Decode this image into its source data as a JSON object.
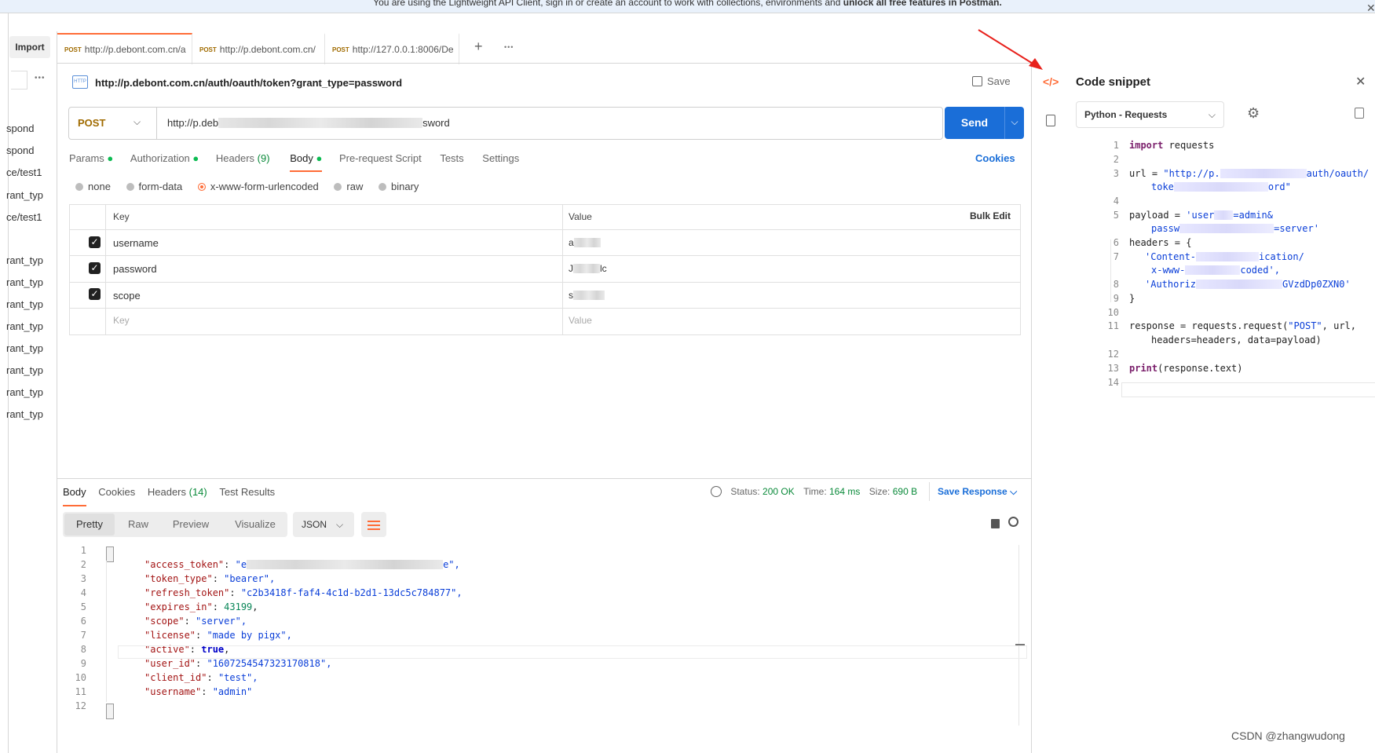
{
  "banner": {
    "text_a": "You are using the Lightweight API Client, sign in or create an account to work with collections, environments and ",
    "text_b": "unlock all free features in Postman."
  },
  "sidebar": {
    "import_label": "Import",
    "items": [
      "spond",
      "spond",
      "ce/test1",
      "rant_typ",
      "ce/test1",
      "rant_typ",
      "rant_typ",
      "rant_typ",
      "rant_typ",
      "rant_typ",
      "rant_typ",
      "rant_typ",
      "rant_typ"
    ]
  },
  "tabs": [
    {
      "method": "POST",
      "url": "http://p.debont.com.cn/a"
    },
    {
      "method": "POST",
      "url": "http://p.debont.com.cn/"
    },
    {
      "method": "POST",
      "url": "http://127.0.0.1:8006/De"
    }
  ],
  "request": {
    "title": "http://p.debont.com.cn/auth/oauth/token?grant_type=password",
    "save_label": "Save",
    "method": "POST",
    "url_start": "http://p.deb",
    "url_end": "sword",
    "send_label": "Send",
    "subtabs": [
      "Params",
      "Authorization",
      "Headers",
      "(9)",
      "Body",
      "Pre-request Script",
      "Tests",
      "Settings"
    ],
    "cookies_label": "Cookies",
    "body_types": [
      "none",
      "form-data",
      "x-www-form-urlencoded",
      "raw",
      "binary"
    ],
    "table": {
      "key_header": "Key",
      "value_header": "Value",
      "bulk_edit": "Bulk Edit",
      "rows": [
        {
          "key": "username",
          "value": "a"
        },
        {
          "key": "password",
          "value": "J",
          "value_tail": "lc"
        },
        {
          "key": "scope",
          "value": "s"
        }
      ],
      "placeholder_key": "Key",
      "placeholder_value": "Value"
    }
  },
  "response": {
    "tabs": [
      "Body",
      "Cookies",
      "Headers",
      "(14)",
      "Test Results"
    ],
    "status_label": "Status:",
    "status_value": "200 OK",
    "time_label": "Time:",
    "time_value": "164 ms",
    "size_label": "Size:",
    "size_value": "690 B",
    "save_response": "Save Response",
    "views": [
      "Pretty",
      "Raw",
      "Preview",
      "Visualize"
    ],
    "format": "JSON",
    "json_lines": [
      {
        "n": "1",
        "t": "{"
      },
      {
        "n": "2",
        "k": "\"access_token\"",
        "v": "\"e",
        "v2": "e\","
      },
      {
        "n": "3",
        "k": "\"token_type\"",
        "v": "\"bearer\","
      },
      {
        "n": "4",
        "k": "\"refresh_token\"",
        "v": "\"c2b3418f-faf4-4c1d-b2d1-13dc5c784877\","
      },
      {
        "n": "5",
        "k": "\"expires_in\"",
        "num": "43199",
        "tail": ","
      },
      {
        "n": "6",
        "k": "\"scope\"",
        "v": "\"server\","
      },
      {
        "n": "7",
        "k": "\"license\"",
        "v": "\"made by pigx\","
      },
      {
        "n": "8",
        "k": "\"active\"",
        "bool": "true",
        "tail": ","
      },
      {
        "n": "9",
        "k": "\"user_id\"",
        "v": "\"1607254547323170818\","
      },
      {
        "n": "10",
        "k": "\"client_id\"",
        "v": "\"test\","
      },
      {
        "n": "11",
        "k": "\"username\"",
        "v": "\"admin\""
      },
      {
        "n": "12",
        "t": "}"
      }
    ]
  },
  "snippet": {
    "title": "Code snippet",
    "language": "Python - Requests",
    "lines": {
      "l1_kw": "import",
      "l1_rest": " requests",
      "l3_a": "url = ",
      "l3_s": "\"http://p.",
      "l3_s2": "auth/oauth/",
      "l3b_s": "toke",
      "l3b_s2": "ord\"",
      "l5_a": "payload = ",
      "l5_s": "'user",
      "l5_s2": "=admin&",
      "l5b_s": "passw",
      "l5b_s2": "=server'",
      "l6": "headers = {",
      "l7_s": "'Content-",
      "l7_s2": "ication/",
      "l7b_s": "x-www-",
      "l7b_s2": "coded',",
      "l8_s": "'Authoriz",
      "l8_s2": "GVzdDp0ZXN0'",
      "l9": "}",
      "l11_a": "response = requests.request(",
      "l11_s": "\"POST\"",
      "l11_b": ", url,",
      "l11b": "headers=headers, data=payload)",
      "l13_kw": "print",
      "l13_rest": "(response.text)"
    },
    "line_numbers": [
      "1",
      "2",
      "3",
      "",
      "4",
      "5",
      "",
      "6",
      "7",
      "",
      "8",
      "9",
      "10",
      "11",
      "",
      "12",
      "13",
      "14"
    ]
  },
  "watermark": "CSDN @zhangwudong"
}
